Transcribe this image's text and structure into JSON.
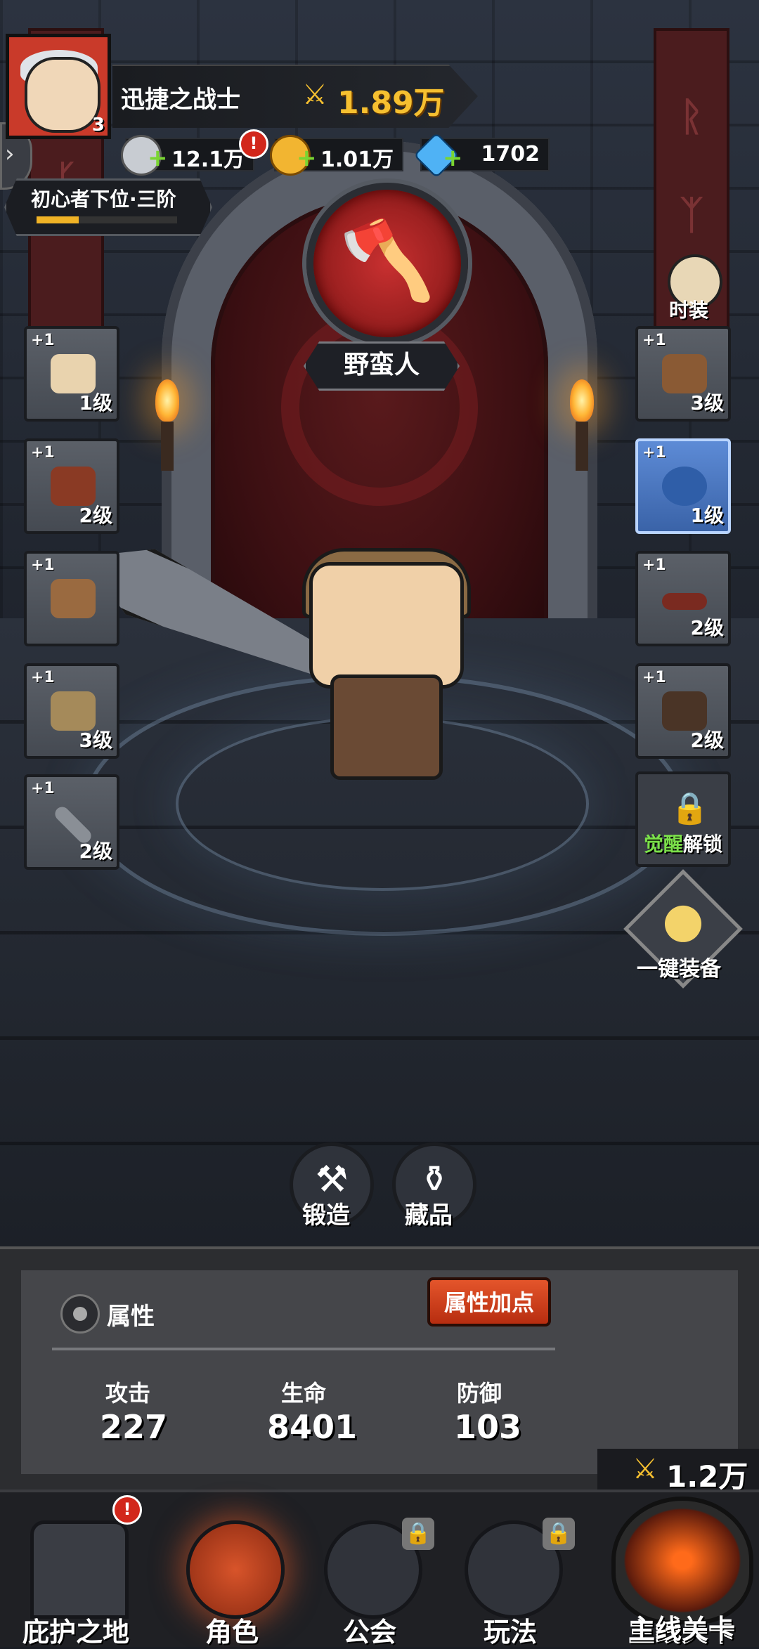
{
  "player": {
    "name": "迅捷之战士",
    "level": "3",
    "power": "1.89万"
  },
  "resources": [
    {
      "icon": "silver-coin-icon",
      "value": "12.1万",
      "color": "#c8ccd2"
    },
    {
      "icon": "gold-coin-icon",
      "value": "1.01万",
      "color": "#f2b531"
    },
    {
      "icon": "diamond-icon",
      "value": "1702",
      "color": "#4fb2f5"
    }
  ],
  "rank": {
    "title": "初心者下位·三阶",
    "progress": 0.3
  },
  "hero_class": {
    "icon": "axe-icon",
    "name": "野蛮人"
  },
  "costume_label": "时装",
  "left_slots": [
    {
      "plus": "+1",
      "level": "1级",
      "icon": "helmet-icon"
    },
    {
      "plus": "+1",
      "level": "2级",
      "icon": "shoulder-guard-icon"
    },
    {
      "plus": "+1",
      "level": "",
      "icon": "bracer-icon"
    },
    {
      "plus": "+1",
      "level": "3级",
      "icon": "armor-icon"
    },
    {
      "plus": "+1",
      "level": "2级",
      "icon": "spear-icon"
    }
  ],
  "right_slots": [
    {
      "plus": "+1",
      "level": "3级",
      "icon": "gauntlet-icon",
      "rarity": "normal"
    },
    {
      "plus": "+1",
      "level": "1级",
      "icon": "spiked-ball-icon",
      "rarity": "blue"
    },
    {
      "plus": "+1",
      "level": "2级",
      "icon": "belt-icon",
      "rarity": "normal"
    },
    {
      "plus": "+1",
      "level": "2级",
      "icon": "boots-icon",
      "rarity": "normal"
    }
  ],
  "awaken_slot": {
    "awaken": "觉醒",
    "unlock": "解锁"
  },
  "equip_all_label": "一键装备",
  "actions": {
    "forge": "锻造",
    "collection": "藏品"
  },
  "attributes": {
    "title": "属性",
    "button": "属性加点",
    "stats": [
      {
        "label": "攻击",
        "value": "227"
      },
      {
        "label": "生命",
        "value": "8401"
      },
      {
        "label": "防御",
        "value": "103"
      }
    ]
  },
  "stage_power": "1.2万",
  "nav": {
    "sanctuary": "庇护之地",
    "character": "角色",
    "guild": "公会",
    "play": "玩法",
    "main_stage": "主线关卡"
  },
  "alert_mark": "!"
}
